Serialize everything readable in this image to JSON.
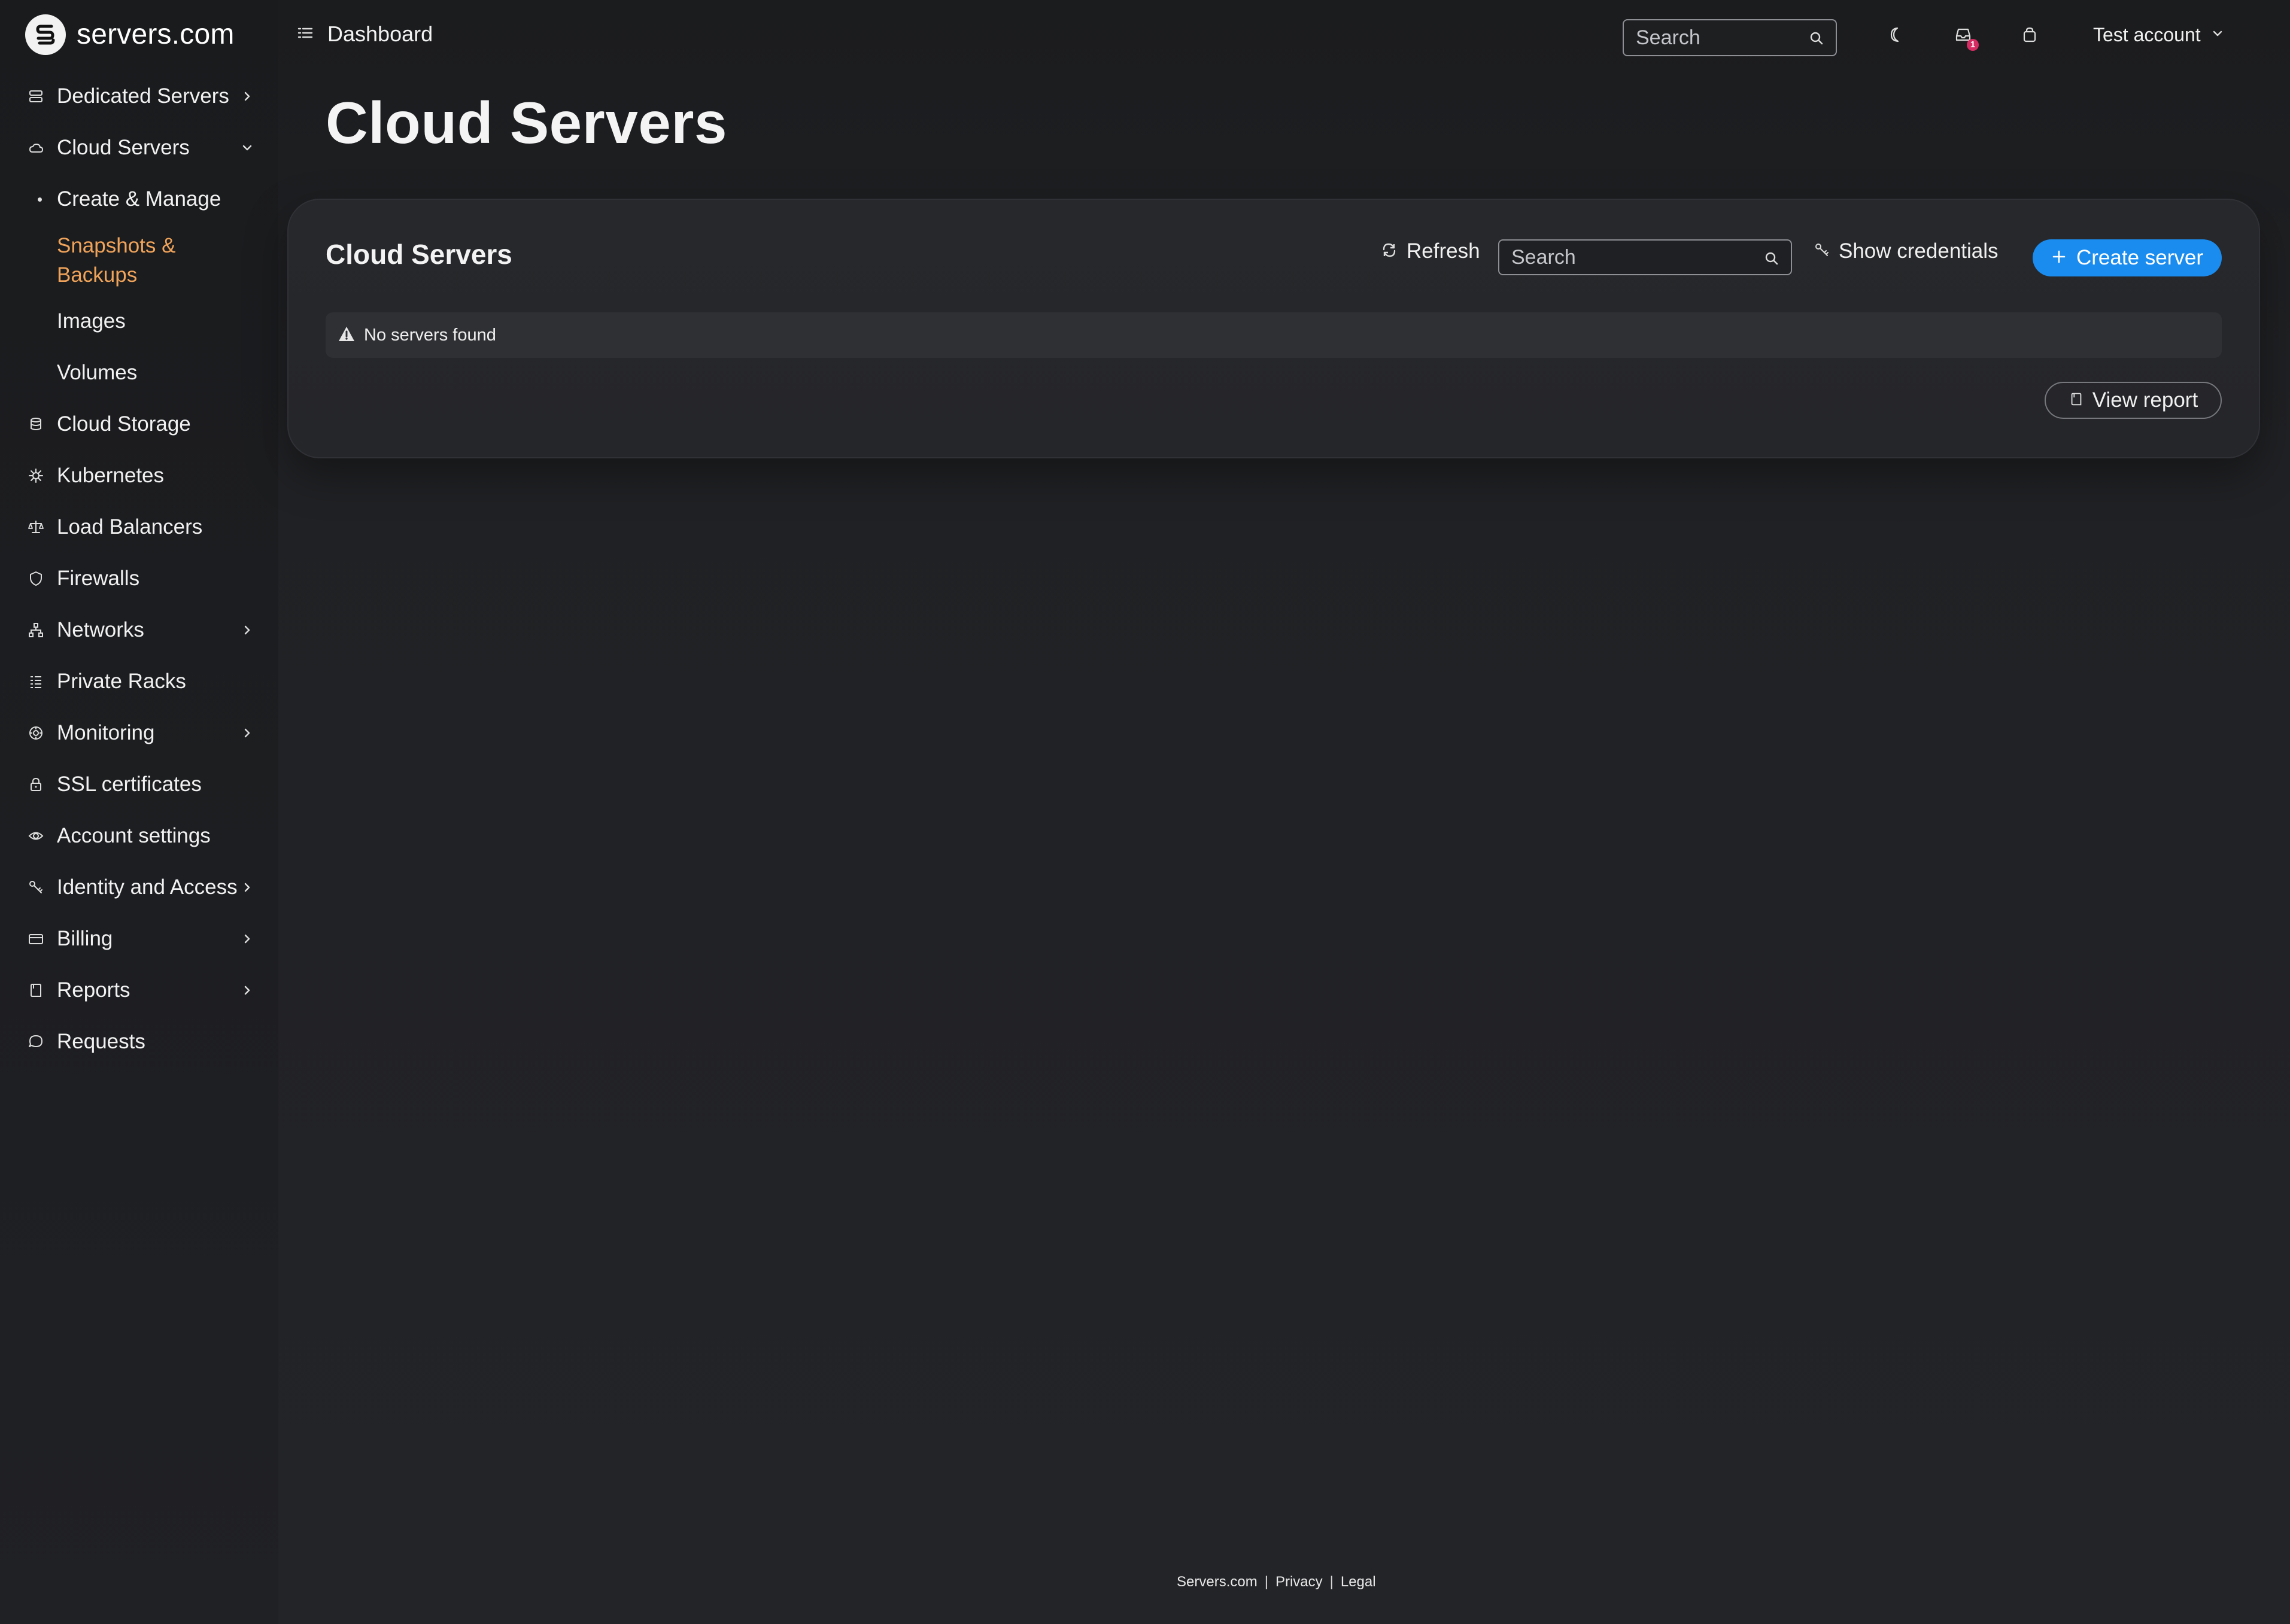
{
  "app": {
    "brand_name": "servers.com"
  },
  "topbar": {
    "dashboard_label": "Dashboard",
    "search_placeholder": "Search",
    "notification_count": "1",
    "account_label": "Test account"
  },
  "sidebar": {
    "items": [
      {
        "label": "Dedicated Servers",
        "icon": "server-icon",
        "expandable": true
      },
      {
        "label": "Cloud Servers",
        "icon": "cloud-icon",
        "expandable": true,
        "expanded": true
      },
      {
        "label": "Create & Manage",
        "icon": "",
        "sub": true
      },
      {
        "label": "Snapshots & Backups",
        "icon": "",
        "sub": true,
        "active": true
      },
      {
        "label": "Images",
        "icon": "",
        "sub": true
      },
      {
        "label": "Volumes",
        "icon": "",
        "sub": true
      },
      {
        "label": "Cloud Storage",
        "icon": "database-icon"
      },
      {
        "label": "Kubernetes",
        "icon": "kubernetes-icon"
      },
      {
        "label": "Load Balancers",
        "icon": "scale-icon"
      },
      {
        "label": "Firewalls",
        "icon": "shield-icon"
      },
      {
        "label": "Networks",
        "icon": "network-icon",
        "expandable": true
      },
      {
        "label": "Private Racks",
        "icon": "rack-icon"
      },
      {
        "label": "Monitoring",
        "icon": "monitoring-icon",
        "expandable": true
      },
      {
        "label": "SSL certificates",
        "icon": "lock-icon"
      },
      {
        "label": "Account settings",
        "icon": "eye-icon"
      },
      {
        "label": "Identity and Access",
        "icon": "key-icon",
        "expandable": true
      },
      {
        "label": "Billing",
        "icon": "card-icon",
        "expandable": true
      },
      {
        "label": "Reports",
        "icon": "report-icon",
        "expandable": true
      },
      {
        "label": "Requests",
        "icon": "chat-icon"
      }
    ]
  },
  "main": {
    "page_title": "Cloud Servers",
    "card": {
      "title": "Cloud Servers",
      "refresh_label": "Refresh",
      "search_placeholder": "Search",
      "show_credentials_label": "Show credentials",
      "create_server_label": "Create server",
      "empty_message": "No servers found",
      "view_report_label": "View report"
    }
  },
  "footer": {
    "links": [
      "Servers.com",
      "Privacy",
      "Legal"
    ]
  },
  "colors": {
    "accent": "#1a8cf0",
    "active_nav": "#f0a35a",
    "badge": "#d62c63",
    "background": "#202124"
  }
}
